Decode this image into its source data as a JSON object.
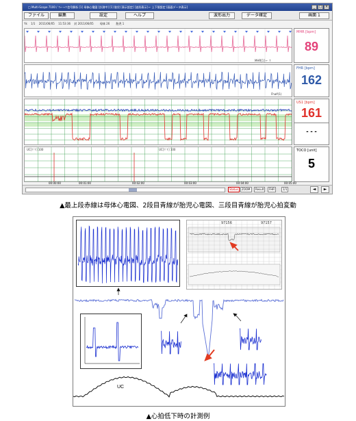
{
  "window": {
    "title": "□ Multi-Scope 7100 / ↑←→↑信号解析 [1] 母体心電図 [計測中] [1] 胎児 [表示設定] [波形表示] ← 上下限設定 [画面データ表示]",
    "controls": [
      "_",
      "□",
      "×"
    ]
  },
  "menu": {
    "file": "ファイル",
    "edit": "編集",
    "settings": "設定",
    "help": "ヘルプ",
    "waveform_output": "波形出力",
    "data_confirm": "データ確定",
    "screen": "画面 1"
  },
  "infobar": "Yk　 1/1　 2011/06/05　 11:53:36　 対 2011/06/05　　 母体 26　　 胎児 1",
  "panels": {
    "mhr": {
      "name": "MHR [bpm]",
      "value": "89",
      "color": "#e3427a",
      "foot_label": "MHR[1] ← ↑"
    },
    "fhr": {
      "name": "FHR [bpm]",
      "value": "162",
      "color": "#2f5aa8",
      "foot_label": "Fhalf(1)"
    },
    "us1": {
      "name": "US1 [bpm]",
      "value": "161",
      "color": "#e0302a",
      "extra": "- - -"
    },
    "toco": {
      "name": "TOCO [unit]",
      "value": "5",
      "color": "#000000",
      "left_label": "UC[↑↑] 100",
      "mid_label": "UC[↑↑] 100"
    }
  },
  "time_ticks": [
    "00:00:00",
    "00:01:00",
    "00:02:00",
    "00:03:00",
    "00:04:00",
    "00:05:00"
  ],
  "bottombar": {
    "status": "Status",
    "zoom": "ZOOM",
    "result": "Result",
    "result_val": "FHR",
    "count": "1/1",
    "prev": "◄",
    "next": "►"
  },
  "caption1": "▲最上段赤線は母体心電図、2段目青線が胎児心電図、三段目青線が胎児心拍変動",
  "caption2": "▲心拍低下時の計測例",
  "figure": {
    "uc_label": "UC",
    "ctg_times": [
      "97156",
      "97157"
    ]
  },
  "colors": {
    "mhr_trace": "#e66796",
    "fhr_trace": "#3358b5",
    "grid_green": "#2e9a43",
    "fhr_curve": "#5a6fd6",
    "arrow_red": "#e23a20"
  }
}
